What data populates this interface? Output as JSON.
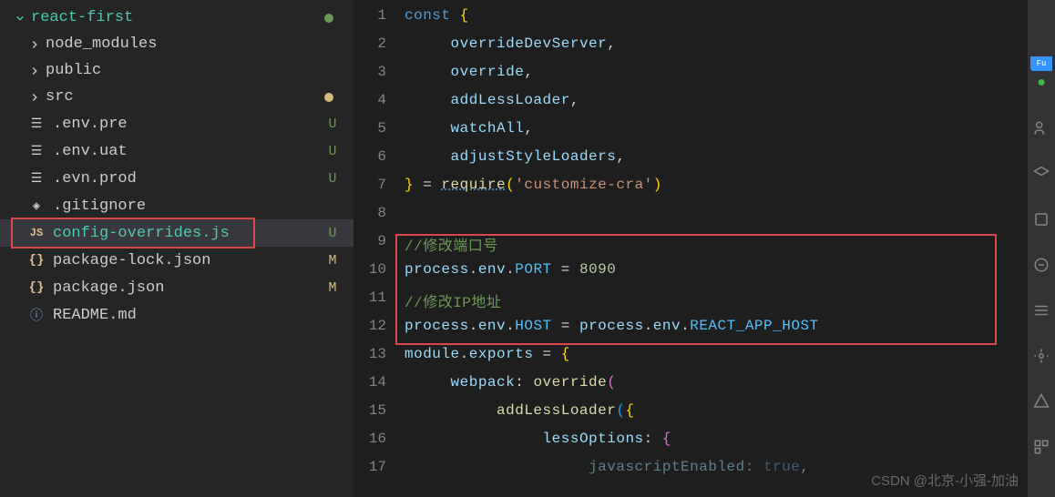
{
  "explorer": {
    "root": "react-first",
    "items": [
      {
        "label": "node_modules",
        "type": "folder",
        "status": ""
      },
      {
        "label": "public",
        "type": "folder",
        "status": ""
      },
      {
        "label": "src",
        "type": "folder",
        "status": "dot-yellow"
      },
      {
        "label": ".env.pre",
        "type": "env",
        "status": "U"
      },
      {
        "label": ".env.uat",
        "type": "env",
        "status": "U"
      },
      {
        "label": ".evn.prod",
        "type": "env",
        "status": "U"
      },
      {
        "label": ".gitignore",
        "type": "git",
        "status": ""
      },
      {
        "label": "config-overrides.js",
        "type": "js",
        "status": "U",
        "selected": true
      },
      {
        "label": "package-lock.json",
        "type": "json",
        "status": "M"
      },
      {
        "label": "package.json",
        "type": "json",
        "status": "M"
      },
      {
        "label": "README.md",
        "type": "info",
        "status": ""
      }
    ]
  },
  "editor": {
    "lines": {
      "l1_const": "const",
      "l1_brace": "{",
      "l2": "overrideDevServer",
      "l3": "override",
      "l4": "addLessLoader",
      "l5": "watchAll",
      "l6": "adjustStyleLoaders",
      "l7_eq": " = ",
      "l7_require": "require",
      "l7_str": "'customize-cra'",
      "l9_comment": "//修改端口号",
      "l10_process": "process",
      "l10_env": "env",
      "l10_port": "PORT",
      "l10_val": "8090",
      "l11_comment": "//修改IP地址",
      "l12_host": "HOST",
      "l12_react": "REACT_APP_HOST",
      "l13_module": "module",
      "l13_exports": "exports",
      "l14_webpack": "webpack",
      "l14_override": "override",
      "l15_fn": "addLessLoader",
      "l16_opt": "lessOptions",
      "l17_key": "javascriptEnabled",
      "l17_val": "true"
    },
    "lineNumbers": [
      "1",
      "2",
      "3",
      "4",
      "5",
      "6",
      "7",
      "8",
      "9",
      "10",
      "11",
      "12",
      "13",
      "14",
      "15",
      "16",
      "17"
    ]
  },
  "watermark": "CSDN @北京-小强-加油"
}
